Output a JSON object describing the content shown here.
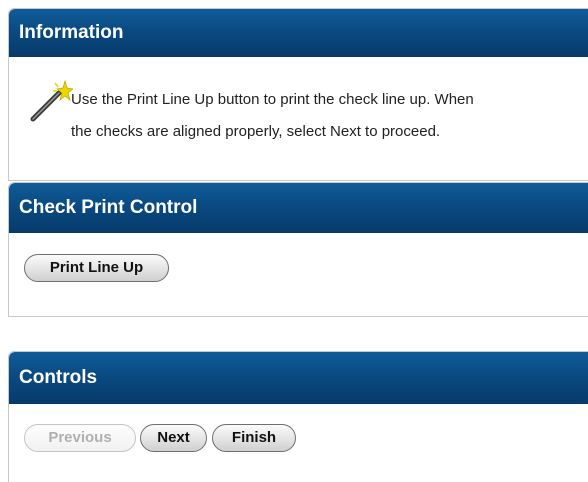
{
  "information": {
    "title": "Information",
    "text_line1": "Use the Print Line Up button to print the check line up.  When",
    "text_line2": "the checks are aligned properly, select Next to proceed."
  },
  "check_print_control": {
    "title": "Check Print Control",
    "print_line_up_label": "Print Line Up"
  },
  "controls": {
    "title": "Controls",
    "previous_label": "Previous",
    "next_label": "Next",
    "finish_label": "Finish"
  },
  "colors": {
    "header_blue": "#0a4a82",
    "header_text": "#ffffff",
    "wand_star": "#e8d800"
  },
  "icons": {
    "information": "magic-wand-icon"
  }
}
